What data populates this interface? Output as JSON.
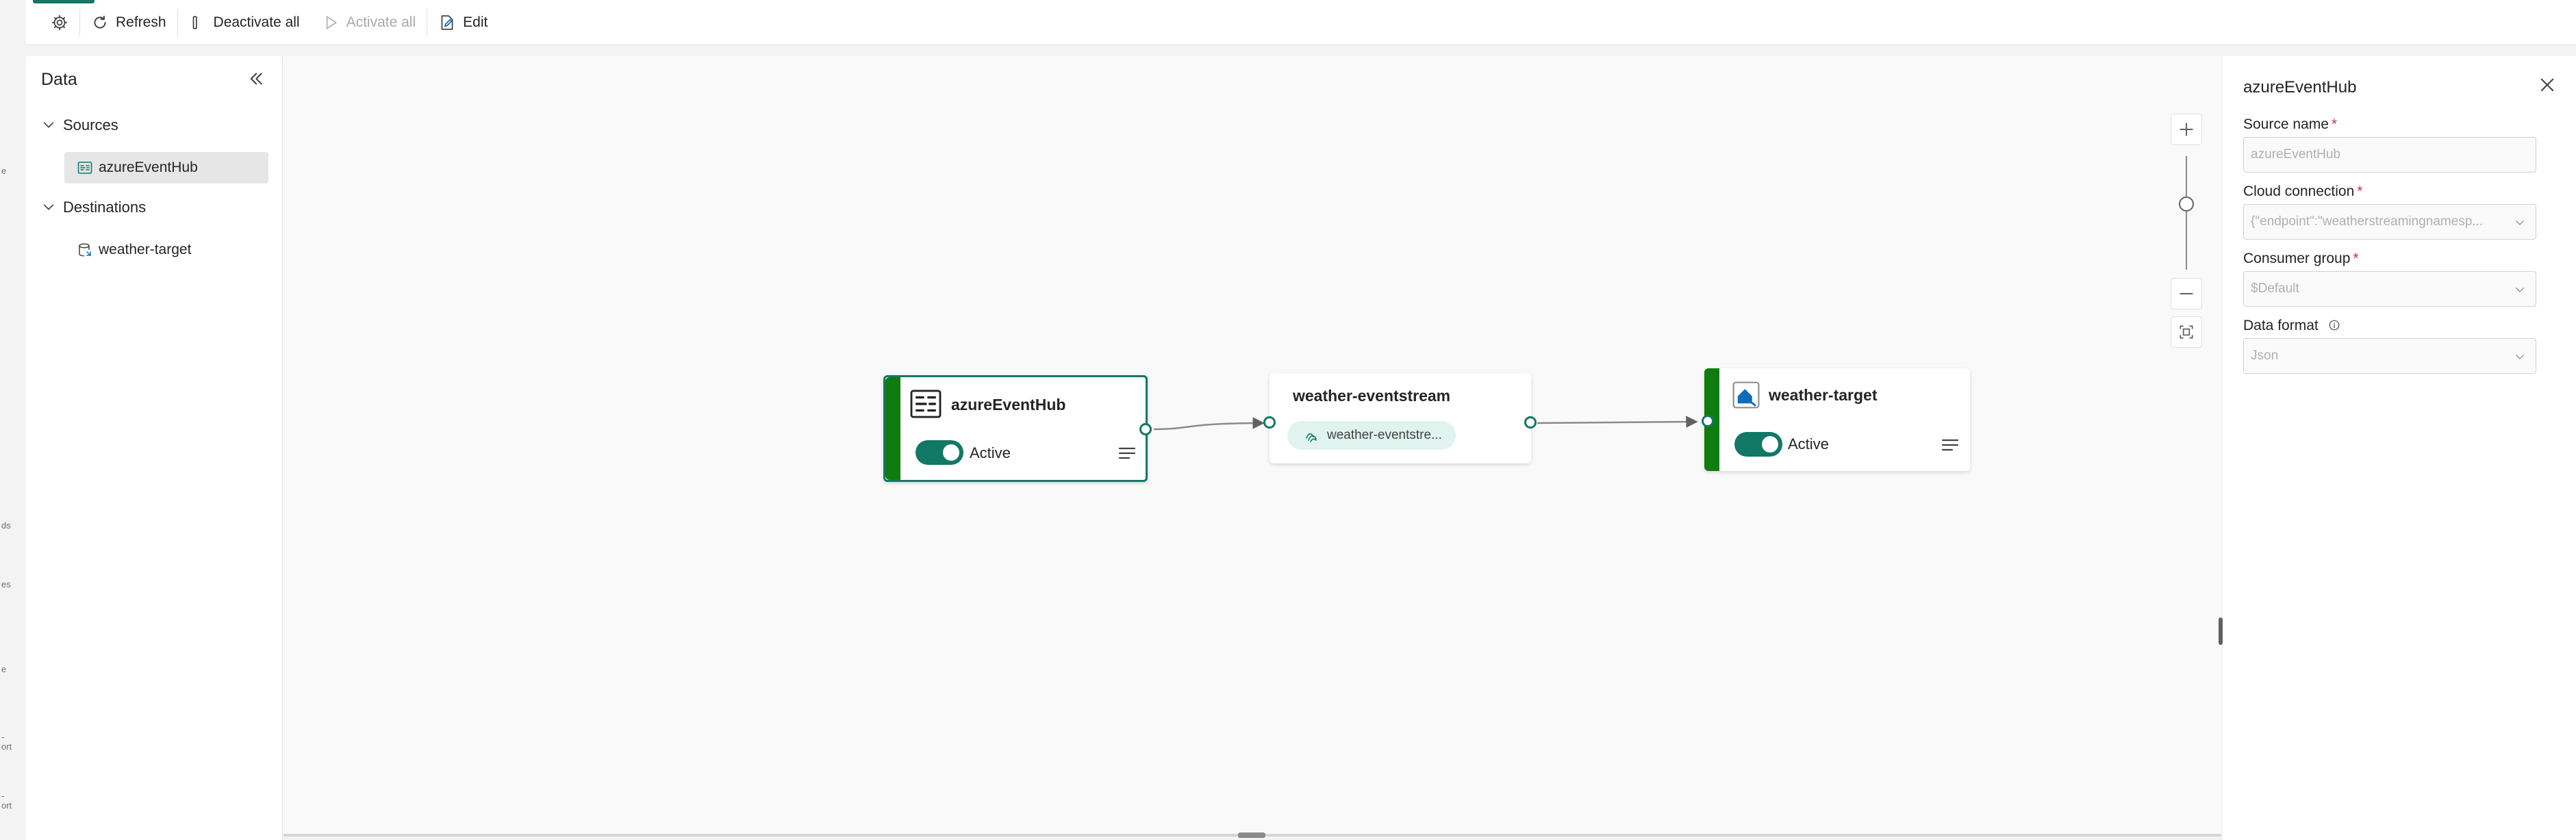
{
  "toolbar": {
    "refresh": "Refresh",
    "deactivate_all": "Deactivate all",
    "activate_all": "Activate all",
    "edit": "Edit"
  },
  "edge_strip": [
    "e",
    "ds",
    "es",
    "e",
    "-\nort",
    "-\nort"
  ],
  "data_panel": {
    "title": "Data",
    "groups": [
      {
        "label": "Sources",
        "items": [
          {
            "label": "azureEventHub",
            "selected": true
          }
        ]
      },
      {
        "label": "Destinations",
        "items": [
          {
            "label": "weather-target",
            "selected": false
          }
        ]
      }
    ]
  },
  "canvas": {
    "source_node": {
      "title": "azureEventHub",
      "status": "Active"
    },
    "stream_node": {
      "title": "weather-eventstream",
      "chip": "weather-eventstre..."
    },
    "dest_node": {
      "title": "weather-target",
      "status": "Active"
    }
  },
  "properties": {
    "title": "azureEventHub",
    "fields": {
      "source_name": {
        "label": "Source name",
        "required": "*",
        "value": "azureEventHub"
      },
      "cloud_connection": {
        "label": "Cloud connection",
        "required": "*",
        "value": "{\"endpoint\":\"weatherstreamingnamesp..."
      },
      "consumer_group": {
        "label": "Consumer group",
        "required": "*",
        "value": "$Default"
      },
      "data_format": {
        "label": "Data format",
        "value": "Json"
      }
    }
  },
  "colors": {
    "accent": "#117865",
    "status_bar": "#107c10",
    "required": "#c4314b"
  }
}
